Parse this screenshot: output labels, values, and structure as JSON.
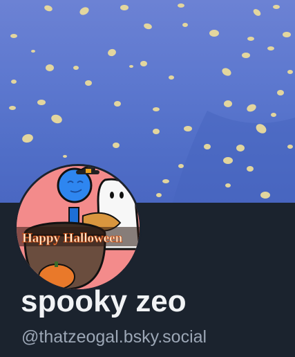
{
  "profile": {
    "display_name": "spooky zeo",
    "handle": "@thatzeogal.bsky.social"
  },
  "banner": {
    "description_icon": "falling-leaves-banner",
    "accent_colors": [
      "#6c82d4",
      "#4a67c2",
      "#e8d89a"
    ]
  },
  "avatar": {
    "icon": "halloween-avatar",
    "caption": "Happy Halloween"
  },
  "colors": {
    "page_bg": "#1b232e",
    "name_text": "#f1f3f5",
    "handle_text": "#9ca7b6"
  }
}
